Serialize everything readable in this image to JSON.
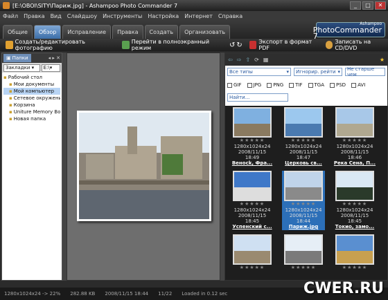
{
  "window": {
    "title": "[E:\\OBOI\\SITY\\Париж.jpg] - Ashampoo Photo Commander 7"
  },
  "menu": [
    "Файл",
    "Правка",
    "Вид",
    "Слайдшоу",
    "Инструменты",
    "Настройка",
    "Интернет",
    "Справка"
  ],
  "tabs": [
    {
      "label": "Общие",
      "active": false
    },
    {
      "label": "Обзор",
      "active": true
    },
    {
      "label": "Исправление",
      "active": false
    },
    {
      "label": "Правка",
      "active": false
    },
    {
      "label": "Создать",
      "active": false
    },
    {
      "label": "Организовать",
      "active": false
    }
  ],
  "logo": {
    "brand": "Ashampoo",
    "product": "PhotoCommander 7"
  },
  "toolbar": {
    "create_edit": "Создать/редактировать фотографию",
    "fullscreen": "Перейти в полноэкранный режим",
    "export_pdf": "Экспорт в формат PDF",
    "burn": "Записать на CD/DVD"
  },
  "left_panel": {
    "tab_label": "Папки",
    "bookmarks_label": "Закладки",
    "drive_label": "E:\\",
    "tree": [
      {
        "label": "Рабочий стол",
        "selected": false,
        "indent": 0
      },
      {
        "label": "Мои документы",
        "selected": false,
        "indent": 1
      },
      {
        "label": "Мой компьютер",
        "selected": true,
        "indent": 1
      },
      {
        "label": "Сетевое окружение",
        "selected": false,
        "indent": 1
      },
      {
        "label": "Корзина",
        "selected": false,
        "indent": 1
      },
      {
        "label": "Uniture Memory Boo",
        "selected": false,
        "indent": 1
      },
      {
        "label": "Новая папка",
        "selected": false,
        "indent": 1
      }
    ]
  },
  "filters": {
    "types": "Все типы",
    "ignore": "Игнорир. рейти",
    "age": "Не старше чем",
    "checkboxes": [
      "GIF",
      "JPG",
      "PNG",
      "TIF",
      "TGA",
      "PSD",
      "AVI"
    ],
    "search_placeholder": "Найти..."
  },
  "thumbs": [
    {
      "info": "1280x1024x24",
      "date": "2008/11/15 18:49",
      "name": "Веносk, Фра...",
      "selected": false,
      "sky": "#7fb0e0",
      "ground": "#8a7a60"
    },
    {
      "info": "1280x1024x24",
      "date": "2008/11/15 18:47",
      "name": "Церковь св...",
      "selected": false,
      "sky": "#9cc8ee",
      "ground": "#4a7ab0"
    },
    {
      "info": "1280x1024x24",
      "date": "2008/11/15 18:46",
      "name": "Река Сена, П...",
      "selected": false,
      "sky": "#a8c8e8",
      "ground": "#b0a890"
    },
    {
      "info": "1280x1024x24",
      "date": "2008/11/15 18:45",
      "name": "Успенский с...",
      "selected": false,
      "sky": "#3f78c8",
      "ground": "#ddd"
    },
    {
      "info": "1280x1024x24",
      "date": "2008/11/15 18:44",
      "name": "Париж.jpg",
      "selected": true,
      "sky": "#c0d4ea",
      "ground": "#8a8a8a"
    },
    {
      "info": "1280x1024x24",
      "date": "2008/11/15 18:45",
      "name": "Токио, замо...",
      "selected": false,
      "sky": "#d9e8f4",
      "ground": "#2a3a2a"
    },
    {
      "info": "",
      "date": "",
      "name": "",
      "selected": false,
      "sky": "#cfe0f2",
      "ground": "#9a8a70"
    },
    {
      "info": "",
      "date": "",
      "name": "",
      "selected": false,
      "sky": "#e6eef6",
      "ground": "#7a7a7a"
    },
    {
      "info": "",
      "date": "",
      "name": "",
      "selected": false,
      "sky": "#5a8fd0",
      "ground": "#c8a050"
    }
  ],
  "status": {
    "dims": "1280x1024x24 -> 22%",
    "size": "282.88 KB",
    "date": "2008/11/15 18:44",
    "index": "11/22",
    "loaded": "Loaded in 0.12 sec"
  },
  "watermark": "CWER.RU"
}
